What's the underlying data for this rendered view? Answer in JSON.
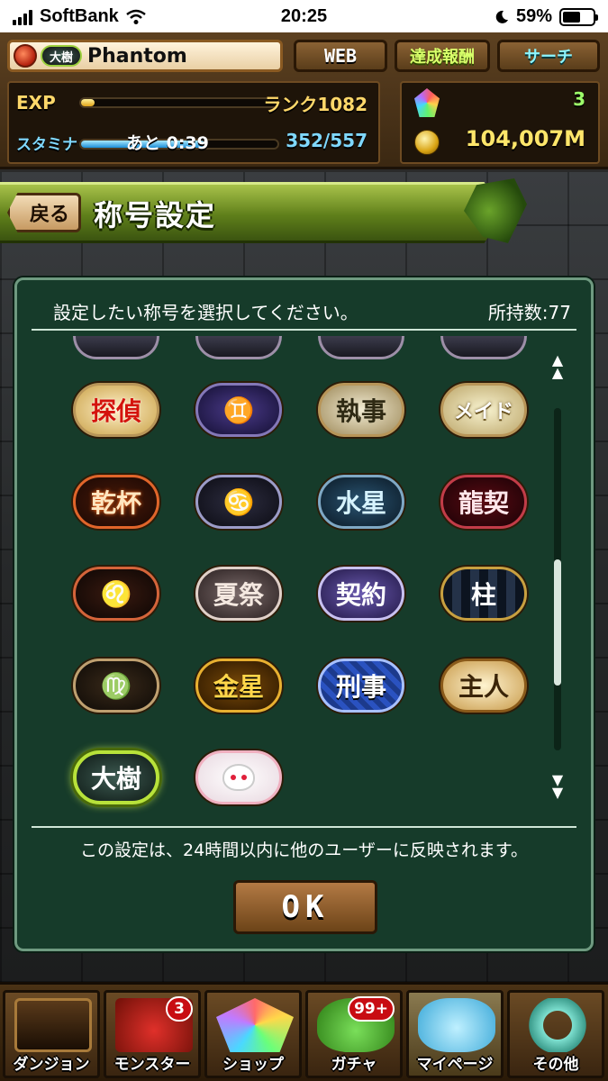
{
  "status_bar": {
    "carrier": "SoftBank",
    "time": "20:25",
    "battery": "59%",
    "battery_level": 0.59
  },
  "header": {
    "player_title_badge": "大樹",
    "player_name": "Phantom",
    "buttons": {
      "web": "WEB",
      "achievements": "達成報酬",
      "search": "サーチ"
    },
    "exp_label": "EXP",
    "exp_progress": 0.07,
    "rank_text": "ランク1082",
    "stamina_label": "スタミナ",
    "stamina_timer": "あと 0:39",
    "stamina_value": "352/557",
    "stamina_progress": 0.63,
    "magic_stones": "3",
    "coins": "104,007M"
  },
  "page": {
    "back_label": "戻る",
    "title": "称号設定"
  },
  "dialog": {
    "instruction": "設定したい称号を選択してください。",
    "owned": "所持数:77",
    "titles": [
      {
        "text": "探偵",
        "style": "c-tantei"
      },
      {
        "text": "♊",
        "style": "c-gemini"
      },
      {
        "text": "執事",
        "style": "c-shitsuji"
      },
      {
        "text": "メイド",
        "style": "c-maid"
      },
      {
        "text": "乾杯",
        "style": "c-kanpai"
      },
      {
        "text": "♋",
        "style": "c-cancer"
      },
      {
        "text": "水星",
        "style": "c-suisei"
      },
      {
        "text": "龍契",
        "style": "c-ryukei"
      },
      {
        "text": "♌",
        "style": "c-leo"
      },
      {
        "text": "夏祭",
        "style": "c-natsumatsuri"
      },
      {
        "text": "契約",
        "style": "c-keiyaku"
      },
      {
        "text": "柱",
        "style": "c-hashira"
      },
      {
        "text": "♍",
        "style": "c-virgo"
      },
      {
        "text": "金星",
        "style": "c-kinsei"
      },
      {
        "text": "刑事",
        "style": "c-keiji"
      },
      {
        "text": "主人",
        "style": "c-shujin"
      },
      {
        "text": "大樹",
        "style": "c-taiju",
        "selected": true
      },
      {
        "text": "",
        "style": "c-kyubey",
        "icon": "kyubey-icon"
      }
    ],
    "scroll_position": 0.7,
    "note": "この設定は、24時間以内に他のユーザーに反映されます。",
    "ok_label": "OK"
  },
  "nav": {
    "items": [
      {
        "label": "ダンジョン",
        "icon": "dungeon-icon",
        "art": "art-dungeon"
      },
      {
        "label": "モンスター",
        "icon": "monster-icon",
        "art": "art-monster",
        "badge": "3"
      },
      {
        "label": "ショップ",
        "icon": "shop-icon",
        "art": "art-shop"
      },
      {
        "label": "ガチャ",
        "icon": "gacha-icon",
        "art": "art-gacha",
        "badge": "99+"
      },
      {
        "label": "マイページ",
        "icon": "mypage-icon",
        "art": "art-mypage",
        "active": true
      },
      {
        "label": "その他",
        "icon": "other-icon",
        "art": "art-other"
      }
    ]
  }
}
